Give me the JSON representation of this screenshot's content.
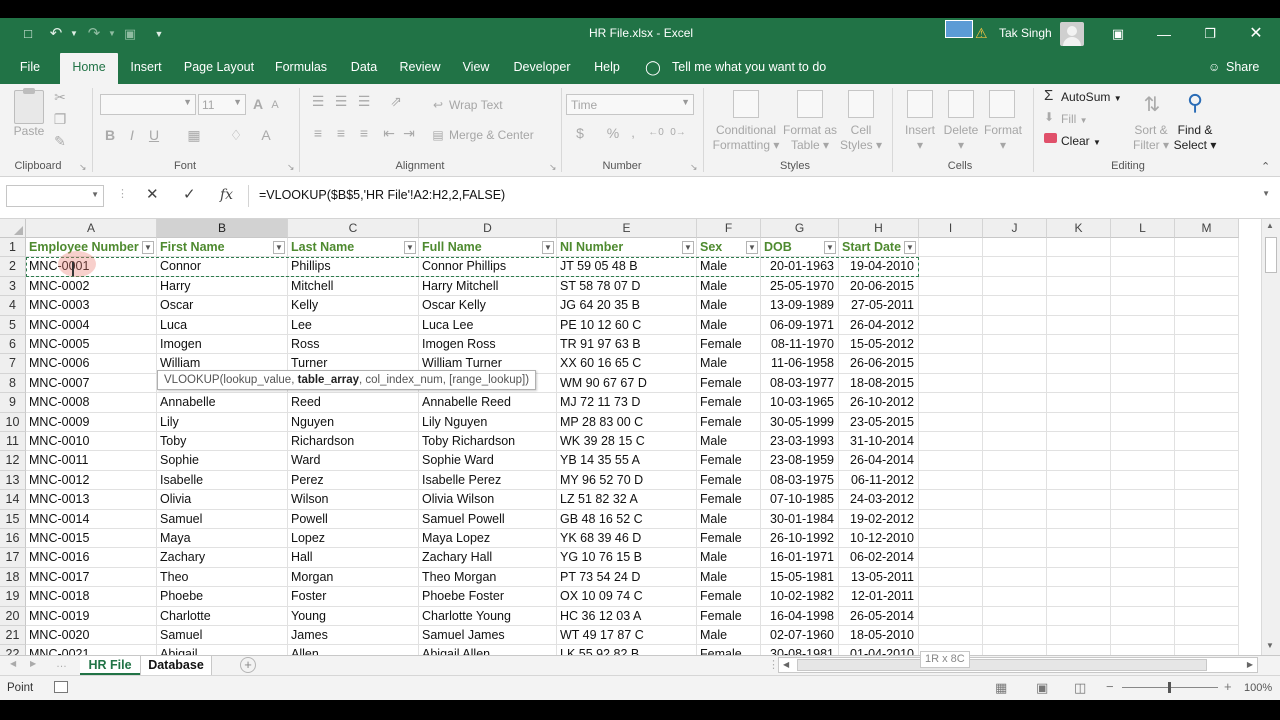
{
  "title": {
    "filename": "HR File.xlsx",
    "separator": "-",
    "app": "Excel",
    "user": "Tak Singh"
  },
  "tabs": [
    "File",
    "Home",
    "Insert",
    "Page Layout",
    "Formulas",
    "Data",
    "Review",
    "View",
    "Developer",
    "Help"
  ],
  "tell_me": "Tell me what you want to do",
  "share": "Share",
  "ribbon": {
    "clipboard": {
      "label": "Clipboard",
      "paste": "Paste"
    },
    "font": {
      "label": "Font",
      "size": "11",
      "bold": "B",
      "italic": "I",
      "underline": "U",
      "font_color": "A"
    },
    "alignment": {
      "label": "Alignment",
      "wrap": "Wrap Text",
      "merge": "Merge & Center"
    },
    "number": {
      "label": "Number",
      "format": "Time",
      "currency": "$",
      "percent": "%"
    },
    "styles": {
      "label": "Styles",
      "conditional": "Conditional",
      "conditional2": "Formatting",
      "format_as": "Format as",
      "table": "Table",
      "cell": "Cell",
      "styles2": "Styles"
    },
    "cells": {
      "label": "Cells",
      "insert": "Insert",
      "delete": "Delete",
      "format": "Format"
    },
    "editing": {
      "label": "Editing",
      "autosum": "AutoSum",
      "fill": "Fill",
      "clear": "Clear",
      "sort": "Sort &",
      "filter": "Filter",
      "find": "Find &",
      "select": "Select"
    }
  },
  "formula_bar": {
    "name_box": "",
    "fx": "fx",
    "formula": "=VLOOKUP($B$5,'HR File'!A2:H2,2,FALSE)"
  },
  "tooltip": {
    "fn": "VLOOKUP(lookup_value, ",
    "bold": "table_array",
    "rest": ", col_index_num, [range_lookup])"
  },
  "columns": [
    "A",
    "B",
    "C",
    "D",
    "E",
    "F",
    "G",
    "H",
    "I",
    "J",
    "K",
    "L",
    "M"
  ],
  "headers": [
    "Employee Number",
    "First Name",
    "Last Name",
    "Full Name",
    "NI Number",
    "Sex",
    "DOB",
    "Start Date"
  ],
  "rows": [
    [
      "MNC-0001",
      "Connor",
      "Phillips",
      "Connor Phillips",
      "JT 59 05 48 B",
      "Male",
      "20-01-1963",
      "19-04-2010"
    ],
    [
      "MNC-0002",
      "Harry",
      "Mitchell",
      "Harry Mitchell",
      "ST 58 78 07 D",
      "Male",
      "25-05-1970",
      "20-06-2015"
    ],
    [
      "MNC-0003",
      "Oscar",
      "Kelly",
      "Oscar Kelly",
      "JG 64 20 35 B",
      "Male",
      "13-09-1989",
      "27-05-2011"
    ],
    [
      "MNC-0004",
      "Luca",
      "Lee",
      "Luca Lee",
      "PE 10 12 60 C",
      "Male",
      "06-09-1971",
      "26-04-2012"
    ],
    [
      "MNC-0005",
      "Imogen",
      "Ross",
      "Imogen Ross",
      "TR 91 97 63 B",
      "Female",
      "08-11-1970",
      "15-05-2012"
    ],
    [
      "MNC-0006",
      "William",
      "Turner",
      "William Turner",
      "XX 60 16 65 C",
      "Male",
      "11-06-1958",
      "26-06-2015"
    ],
    [
      "MNC-0007",
      "",
      "",
      "",
      "WM 90 67 67 D",
      "Female",
      "08-03-1977",
      "18-08-2015"
    ],
    [
      "MNC-0008",
      "Annabelle",
      "Reed",
      "Annabelle Reed",
      "MJ 72 11 73 D",
      "Female",
      "10-03-1965",
      "26-10-2012"
    ],
    [
      "MNC-0009",
      "Lily",
      "Nguyen",
      "Lily Nguyen",
      "MP 28 83 00 C",
      "Female",
      "30-05-1999",
      "23-05-2015"
    ],
    [
      "MNC-0010",
      "Toby",
      "Richardson",
      "Toby Richardson",
      "WK 39 28 15 C",
      "Male",
      "23-03-1993",
      "31-10-2014"
    ],
    [
      "MNC-0011",
      "Sophie",
      "Ward",
      "Sophie Ward",
      "YB 14 35 55 A",
      "Female",
      "23-08-1959",
      "26-04-2014"
    ],
    [
      "MNC-0012",
      "Isabelle",
      "Perez",
      "Isabelle Perez",
      "MY 96 52 70 D",
      "Female",
      "08-03-1975",
      "06-11-2012"
    ],
    [
      "MNC-0013",
      "Olivia",
      "Wilson",
      "Olivia Wilson",
      "LZ 51 82 32 A",
      "Female",
      "07-10-1985",
      "24-03-2012"
    ],
    [
      "MNC-0014",
      "Samuel",
      "Powell",
      "Samuel Powell",
      "GB 48 16 52 C",
      "Male",
      "30-01-1984",
      "19-02-2012"
    ],
    [
      "MNC-0015",
      "Maya",
      "Lopez",
      "Maya Lopez",
      "YK 68 39 46 D",
      "Female",
      "26-10-1992",
      "10-12-2010"
    ],
    [
      "MNC-0016",
      "Zachary",
      "Hall",
      "Zachary Hall",
      "YG 10 76 15 B",
      "Male",
      "16-01-1971",
      "06-02-2014"
    ],
    [
      "MNC-0017",
      "Theo",
      "Morgan",
      "Theo Morgan",
      "PT 73 54 24 D",
      "Male",
      "15-05-1981",
      "13-05-2011"
    ],
    [
      "MNC-0018",
      "Phoebe",
      "Foster",
      "Phoebe Foster",
      "OX 10 09 74 C",
      "Female",
      "10-02-1982",
      "12-01-2011"
    ],
    [
      "MNC-0019",
      "Charlotte",
      "Young",
      "Charlotte Young",
      "HC 36 12 03 A",
      "Female",
      "16-04-1998",
      "26-05-2014"
    ],
    [
      "MNC-0020",
      "Samuel",
      "James",
      "Samuel James",
      "WT 49 17 87 C",
      "Male",
      "02-07-1960",
      "18-05-2010"
    ],
    [
      "MNC-0021",
      "Abigail",
      "Allen",
      "Abigail Allen",
      "LK 55 92 82 B",
      "Female",
      "30-08-1981",
      "01-04-2010"
    ]
  ],
  "sheets": [
    "HR File",
    "Database"
  ],
  "selection_info": "1R x 8C",
  "status": "Point",
  "zoom": "100%",
  "colors": {
    "accent": "#217346",
    "header_text": "#4e8a2f"
  }
}
